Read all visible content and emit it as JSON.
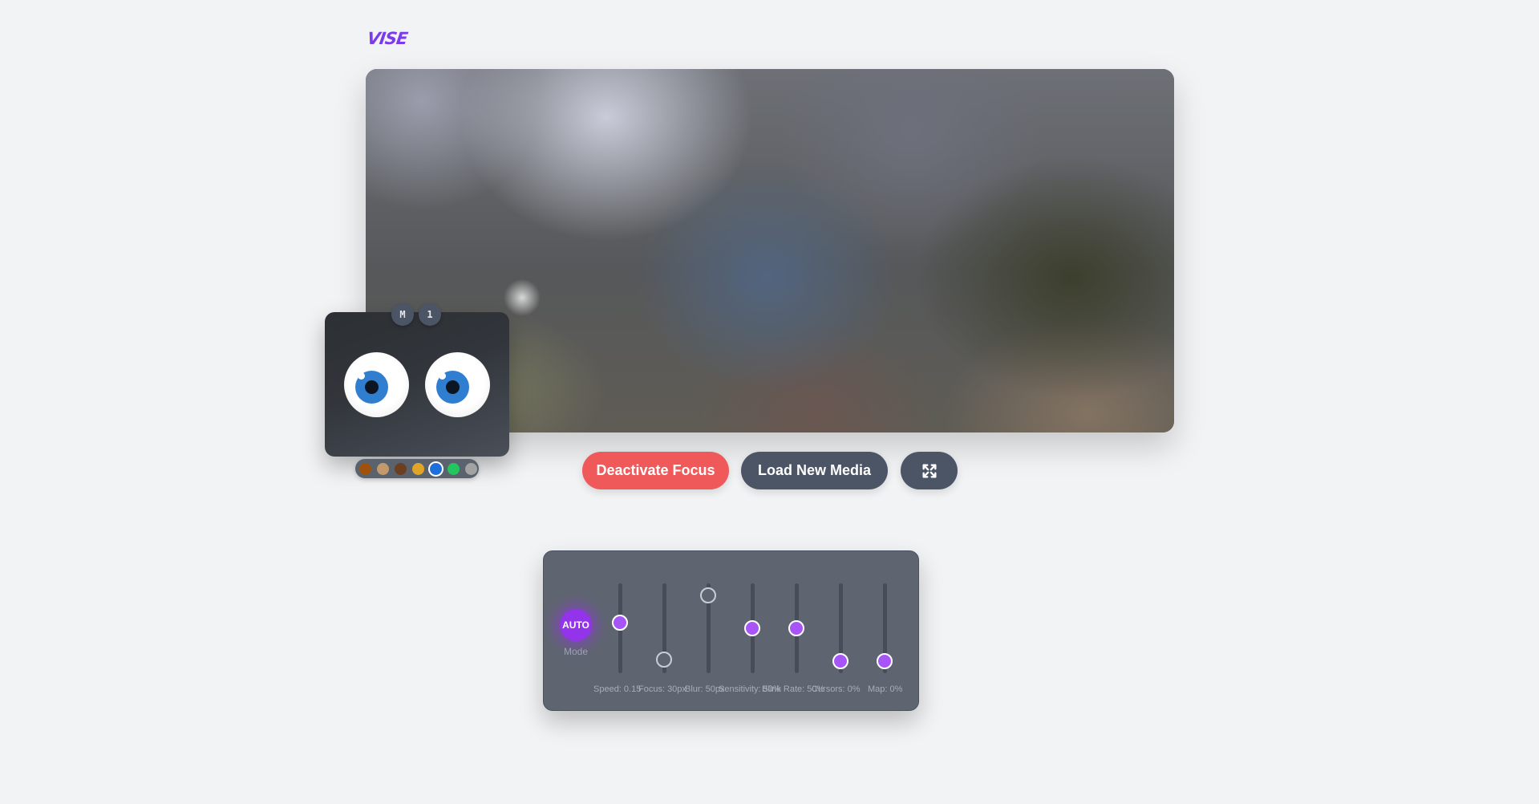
{
  "app": {
    "logo_text": "VISE",
    "brand_color": "#7c3aed"
  },
  "media": {
    "description_blurred": true
  },
  "controls": {
    "deactivate_focus_label": "Deactivate Focus",
    "load_media_label": "Load New Media",
    "fullscreen_icon": "expand-icon",
    "focus_color": "#ef5959",
    "neutral_color": "#4b5565"
  },
  "eyes_widget": {
    "chips": [
      "M",
      "1"
    ],
    "iris_color": "#2f7ecf",
    "palette": [
      {
        "color": "#a0520d",
        "selected": false
      },
      {
        "color": "#c49a6c",
        "selected": false
      },
      {
        "color": "#6b3f1f",
        "selected": false
      },
      {
        "color": "#e0a526",
        "selected": false
      },
      {
        "color": "#1e6fd9",
        "selected": true
      },
      {
        "color": "#22c55e",
        "selected": false
      },
      {
        "color": "#a3a3a3",
        "selected": false
      }
    ]
  },
  "panel": {
    "auto_label": "AUTO",
    "mode_label": "Mode",
    "accent_color": "#a855f7",
    "sliders": [
      {
        "label": "Speed: 0.15",
        "level": 0.57,
        "active": true
      },
      {
        "label": "Focus: 30px",
        "level": 0.12,
        "active": false
      },
      {
        "label": "Blur: 50px",
        "level": 0.9,
        "active": false
      },
      {
        "label": "Sensitivity: 50%",
        "level": 0.5,
        "active": true
      },
      {
        "label": "Blink Rate: 50%",
        "level": 0.5,
        "active": true
      },
      {
        "label": "Cursors: 0%",
        "level": 0.1,
        "active": true
      },
      {
        "label": "Map: 0%",
        "level": 0.1,
        "active": true
      }
    ]
  }
}
